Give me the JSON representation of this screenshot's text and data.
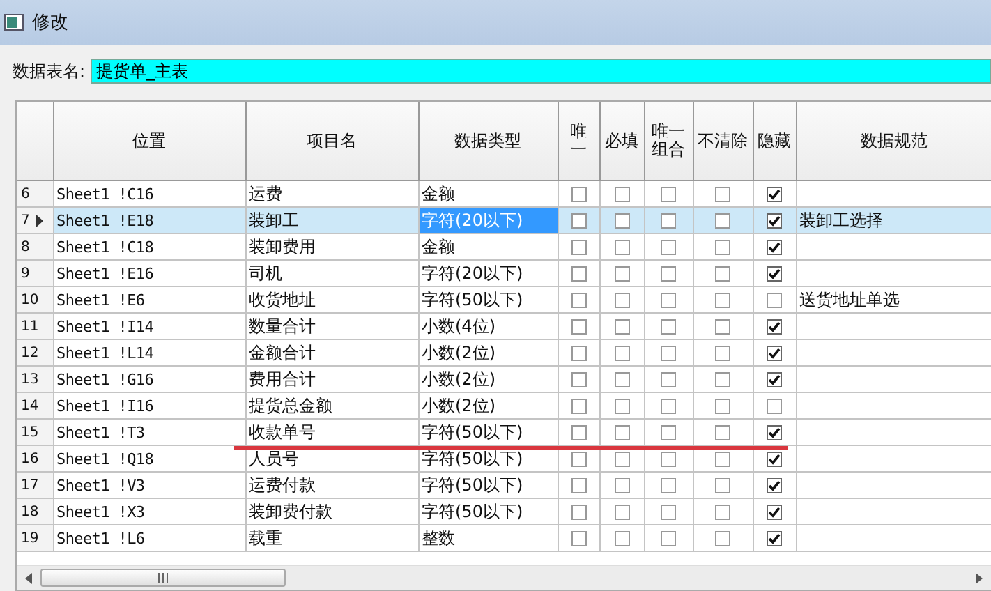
{
  "window": {
    "title": "修改"
  },
  "table_name": {
    "label": "数据表名:",
    "value": "提货单_主表"
  },
  "table": {
    "columns": [
      "位置",
      "项目名",
      "数据类型",
      "唯一",
      "必填",
      "唯一组合",
      "不清除",
      "隐藏",
      "数据规范"
    ],
    "rows": [
      {
        "num": "6",
        "position": "Sheet1 !C16",
        "item": "运费",
        "type": "金额",
        "unique": false,
        "required": false,
        "unique_combo": false,
        "no_clear": false,
        "hidden": true,
        "rule": "",
        "selected": false
      },
      {
        "num": "7",
        "position": "Sheet1 !E18",
        "item": "装卸工",
        "type": "字符(20以下)",
        "unique": false,
        "required": false,
        "unique_combo": false,
        "no_clear": false,
        "hidden": true,
        "rule": "装卸工选择",
        "selected": true
      },
      {
        "num": "8",
        "position": "Sheet1 !C18",
        "item": "装卸费用",
        "type": "金额",
        "unique": false,
        "required": false,
        "unique_combo": false,
        "no_clear": false,
        "hidden": true,
        "rule": "",
        "selected": false
      },
      {
        "num": "9",
        "position": "Sheet1 !E16",
        "item": "司机",
        "type": "字符(20以下)",
        "unique": false,
        "required": false,
        "unique_combo": false,
        "no_clear": false,
        "hidden": true,
        "rule": "",
        "selected": false
      },
      {
        "num": "10",
        "position": "Sheet1 !E6",
        "item": "收货地址",
        "type": "字符(50以下)",
        "unique": false,
        "required": false,
        "unique_combo": false,
        "no_clear": false,
        "hidden": false,
        "rule": "送货地址单选",
        "selected": false
      },
      {
        "num": "11",
        "position": "Sheet1 !I14",
        "item": "数量合计",
        "type": "小数(4位)",
        "unique": false,
        "required": false,
        "unique_combo": false,
        "no_clear": false,
        "hidden": true,
        "rule": "",
        "selected": false
      },
      {
        "num": "12",
        "position": "Sheet1 !L14",
        "item": "金额合计",
        "type": "小数(2位)",
        "unique": false,
        "required": false,
        "unique_combo": false,
        "no_clear": false,
        "hidden": true,
        "rule": "",
        "selected": false
      },
      {
        "num": "13",
        "position": "Sheet1 !G16",
        "item": "费用合计",
        "type": "小数(2位)",
        "unique": false,
        "required": false,
        "unique_combo": false,
        "no_clear": false,
        "hidden": true,
        "rule": "",
        "selected": false
      },
      {
        "num": "14",
        "position": "Sheet1 !I16",
        "item": "提货总金额",
        "type": "小数(2位)",
        "unique": false,
        "required": false,
        "unique_combo": false,
        "no_clear": false,
        "hidden": false,
        "rule": "",
        "selected": false
      },
      {
        "num": "15",
        "position": "Sheet1 !T3",
        "item": "收款单号",
        "type": "字符(50以下)",
        "unique": false,
        "required": false,
        "unique_combo": false,
        "no_clear": false,
        "hidden": true,
        "rule": "",
        "selected": false
      },
      {
        "num": "16",
        "position": "Sheet1 !Q18",
        "item": "人员号",
        "type": "字符(50以下)",
        "unique": false,
        "required": false,
        "unique_combo": false,
        "no_clear": false,
        "hidden": true,
        "rule": "",
        "selected": false
      },
      {
        "num": "17",
        "position": "Sheet1 !V3",
        "item": "运费付款",
        "type": "字符(50以下)",
        "unique": false,
        "required": false,
        "unique_combo": false,
        "no_clear": false,
        "hidden": true,
        "rule": "",
        "selected": false
      },
      {
        "num": "18",
        "position": "Sheet1 !X3",
        "item": "装卸费付款",
        "type": "字符(50以下)",
        "unique": false,
        "required": false,
        "unique_combo": false,
        "no_clear": false,
        "hidden": true,
        "rule": "",
        "selected": false
      },
      {
        "num": "19",
        "position": "Sheet1 !L6",
        "item": "载重",
        "type": "整数",
        "unique": false,
        "required": false,
        "unique_combo": false,
        "no_clear": false,
        "hidden": true,
        "rule": "",
        "selected": false
      }
    ]
  }
}
